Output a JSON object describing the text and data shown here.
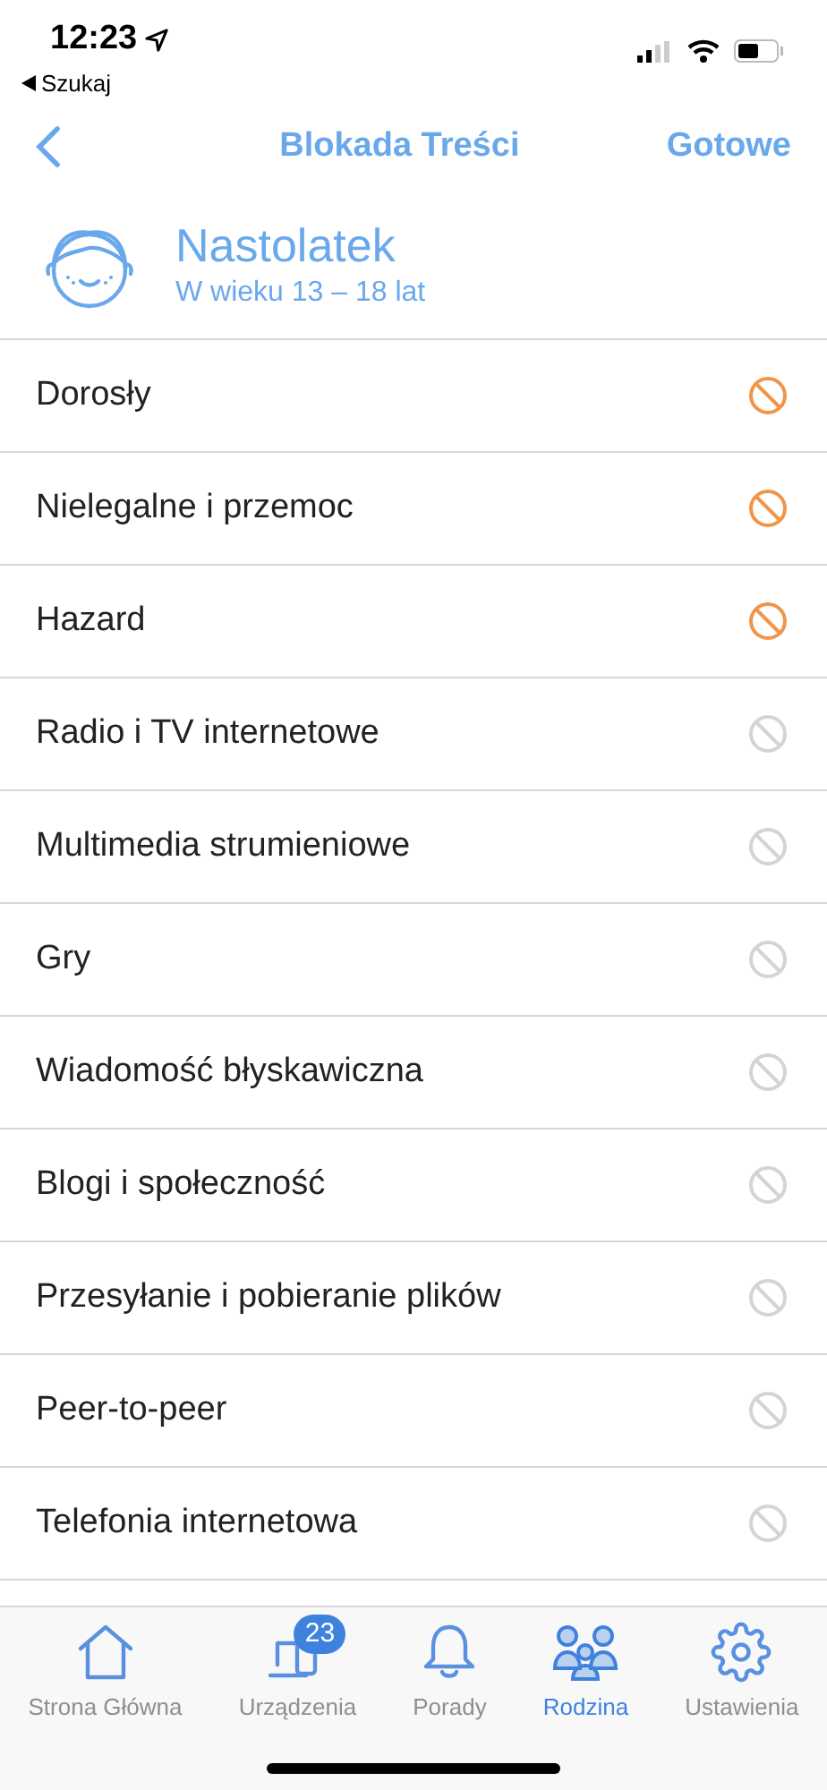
{
  "status_bar": {
    "time": "12:23",
    "back_app": "Szukaj"
  },
  "nav": {
    "title": "Blokada Treści",
    "done": "Gotowe"
  },
  "profile": {
    "name": "Nastolatek",
    "age": "W wieku 13 – 18 lat"
  },
  "categories": [
    {
      "label": "Dorosły",
      "blocked": true
    },
    {
      "label": "Nielegalne i przemoc",
      "blocked": true
    },
    {
      "label": "Hazard",
      "blocked": true
    },
    {
      "label": "Radio i TV internetowe",
      "blocked": false
    },
    {
      "label": "Multimedia strumieniowe",
      "blocked": false
    },
    {
      "label": "Gry",
      "blocked": false
    },
    {
      "label": "Wiadomość błyskawiczna",
      "blocked": false
    },
    {
      "label": "Blogi i społeczność",
      "blocked": false
    },
    {
      "label": "Przesyłanie i pobieranie plików",
      "blocked": false
    },
    {
      "label": "Peer-to-peer",
      "blocked": false
    },
    {
      "label": "Telefonia internetowa",
      "blocked": false
    }
  ],
  "tabs": [
    {
      "kind": "home",
      "label": "Strona Główna",
      "selected": false
    },
    {
      "kind": "devices",
      "label": "Urządzenia",
      "selected": false,
      "badge": "23"
    },
    {
      "kind": "tips",
      "label": "Porady",
      "selected": false
    },
    {
      "kind": "family",
      "label": "Rodzina",
      "selected": true
    },
    {
      "kind": "settings",
      "label": "Ustawienia",
      "selected": false
    }
  ]
}
